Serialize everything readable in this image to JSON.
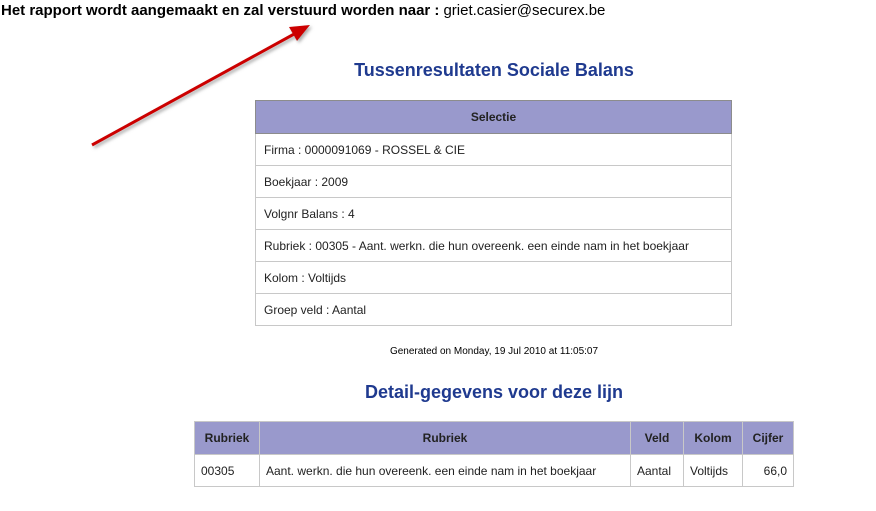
{
  "notice": {
    "label": "Het rapport wordt aangemaakt en zal verstuurd worden naar :",
    "email": "griet.casier@securex.be"
  },
  "section1": {
    "title": "Tussenresultaten Sociale Balans",
    "header": "Selectie",
    "rows": [
      "Firma : 0000091069 - ROSSEL & CIE",
      "Boekjaar : 2009",
      "Volgnr Balans : 4",
      "Rubriek : 00305 - Aant. werkn. die hun overeenk. een einde nam in het boekjaar",
      "Kolom : Voltijds",
      "Groep veld : Aantal"
    ]
  },
  "generated": "Generated on Monday, 19 Jul 2010 at 11:05:07",
  "section2": {
    "title": "Detail-gegevens voor deze lijn",
    "headers": [
      "Rubriek",
      "Rubriek",
      "Veld",
      "Kolom",
      "Cijfer"
    ],
    "row": [
      "00305",
      "Aant. werkn. die hun overeenk. een einde nam in het boekjaar",
      "Aantal",
      "Voltijds",
      "66,0"
    ]
  },
  "colors": {
    "title": "#1f3a8f",
    "header_bg": "#9999cc",
    "arrow": "#cc0000"
  }
}
